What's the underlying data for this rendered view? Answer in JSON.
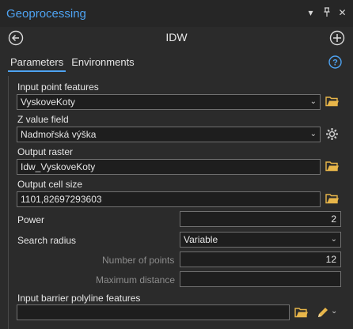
{
  "window": {
    "title": "Geoprocessing",
    "icons": [
      "chevron-down-icon",
      "pin-icon",
      "close-icon"
    ]
  },
  "tool": {
    "name": "IDW"
  },
  "tabs": [
    {
      "label": "Parameters",
      "active": true
    },
    {
      "label": "Environments",
      "active": false
    }
  ],
  "params": {
    "input_point_features": {
      "label": "Input point features",
      "value": "VyskoveKoty"
    },
    "z_value_field": {
      "label": "Z value field",
      "value": "Nadmořská výška"
    },
    "output_raster": {
      "label": "Output raster",
      "value": "Idw_VyskoveKoty"
    },
    "output_cell_size": {
      "label": "Output cell size",
      "value": "1101,82697293603"
    },
    "power": {
      "label": "Power",
      "value": "2"
    },
    "search_radius": {
      "label": "Search radius",
      "value": "Variable"
    },
    "number_of_points": {
      "label": "Number of points",
      "value": "12"
    },
    "maximum_distance": {
      "label": "Maximum distance",
      "value": ""
    },
    "input_barrier": {
      "label": "Input barrier polyline features",
      "value": ""
    }
  },
  "colors": {
    "accent": "#4ea3f2",
    "folder": "#e8b64a",
    "background": "#2b2b2b"
  }
}
